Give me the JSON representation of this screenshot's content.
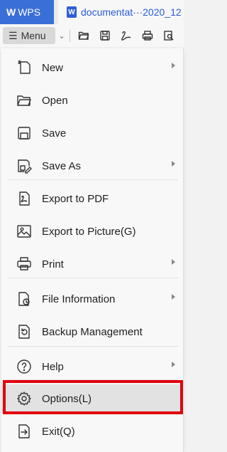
{
  "titlebar": {
    "app_tab": "WPS",
    "doc_tab": "documentat···2020_12"
  },
  "toolbar": {
    "menu_label": "Menu",
    "icons": [
      "open-folder-icon",
      "save-icon",
      "export-pdf-icon",
      "print-icon",
      "print-preview-icon"
    ]
  },
  "menu": {
    "items": [
      {
        "label": "New",
        "icon": "new-document-icon",
        "submenu": true
      },
      {
        "label": "Open",
        "icon": "open-folder-icon",
        "submenu": false
      },
      {
        "label": "Save",
        "icon": "save-icon",
        "submenu": false
      },
      {
        "label": "Save As",
        "icon": "save-as-icon",
        "submenu": true
      },
      {
        "label": "Export to PDF",
        "icon": "export-pdf-icon",
        "submenu": false
      },
      {
        "label": "Export to Picture(G)",
        "icon": "export-picture-icon",
        "submenu": false
      },
      {
        "label": "Print",
        "icon": "print-icon",
        "submenu": true
      },
      {
        "label": "File Information",
        "icon": "file-info-icon",
        "submenu": true
      },
      {
        "label": "Backup Management",
        "icon": "backup-icon",
        "submenu": false
      },
      {
        "label": "Help",
        "icon": "help-icon",
        "submenu": true
      },
      {
        "label": "Options(L)",
        "icon": "options-gear-icon",
        "submenu": false,
        "highlighted": true
      },
      {
        "label": "Exit(Q)",
        "icon": "exit-icon",
        "submenu": false
      }
    ]
  },
  "colors": {
    "brand": "#3a6fd8",
    "highlight_outline": "#e0000e"
  }
}
